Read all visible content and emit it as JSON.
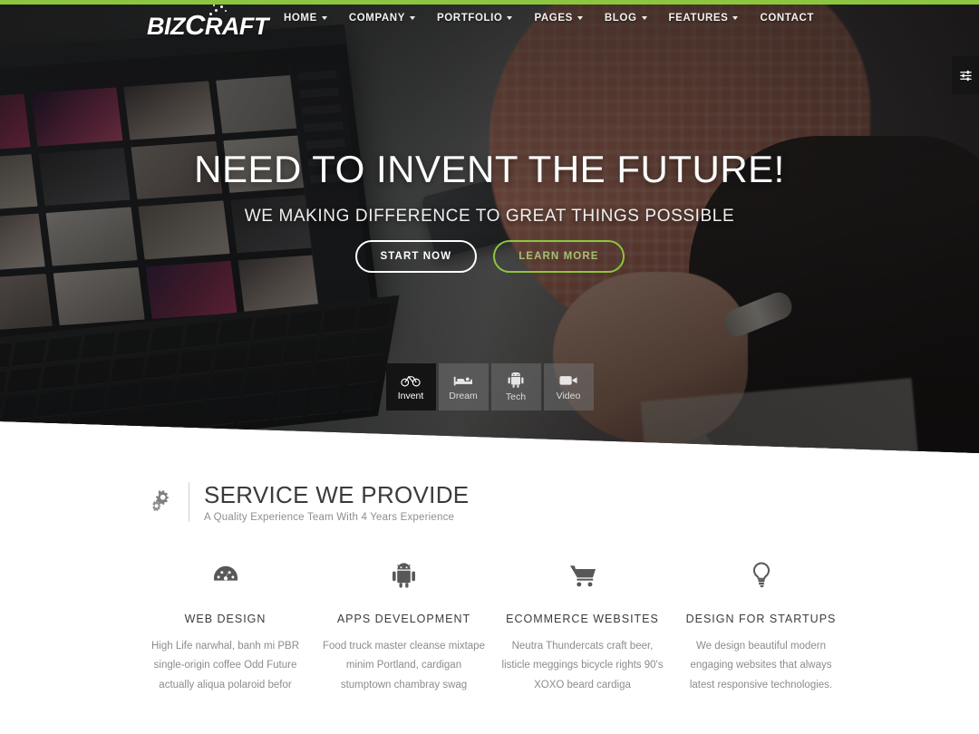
{
  "brand": {
    "logo_text_1": "B",
    "logo_text_2": "IZ",
    "logo_text_3": "C",
    "logo_text_4": "RAFT",
    "accent_color": "#8cc63e"
  },
  "header": {
    "nav": [
      {
        "label": "HOME",
        "has_dropdown": true
      },
      {
        "label": "COMPANY",
        "has_dropdown": true
      },
      {
        "label": "PORTFOLIO",
        "has_dropdown": true
      },
      {
        "label": "PAGES",
        "has_dropdown": true
      },
      {
        "label": "BLOG",
        "has_dropdown": true
      },
      {
        "label": "FEATURES",
        "has_dropdown": true
      },
      {
        "label": "CONTACT",
        "has_dropdown": false
      }
    ],
    "settings_icon": "sliders-icon"
  },
  "hero": {
    "title": "NEED TO INVENT THE FUTURE!",
    "subtitle": "WE MAKING DIFFERENCE TO GREAT THINGS POSSIBLE",
    "primary_button": "START NOW",
    "secondary_button": "LEARN MORE",
    "tabs": [
      {
        "label": "Invent",
        "icon": "bicycle-icon",
        "active": true
      },
      {
        "label": "Dream",
        "icon": "bed-icon",
        "active": false
      },
      {
        "label": "Tech",
        "icon": "android-icon",
        "active": false
      },
      {
        "label": "Video",
        "icon": "video-camera-icon",
        "active": false
      }
    ]
  },
  "services_section": {
    "icon": "gears-icon",
    "title": "SERVICE WE PROVIDE",
    "subtitle": "A Quality Experience Team With 4 Years Experience",
    "items": [
      {
        "icon": "dashboard-icon",
        "title": "WEB DESIGN",
        "description": "High Life narwhal, banh mi PBR single-origin coffee Odd Future actually aliqua polaroid befor"
      },
      {
        "icon": "android-icon",
        "title": "APPS DEVELOPMENT",
        "description": "Food truck master cleanse mixtape minim Portland, cardigan stumptown chambray swag"
      },
      {
        "icon": "shopping-cart-icon",
        "title": "ECOMMERCE WEBSITES",
        "description": "Neutra Thundercats craft beer, listicle meggings bicycle rights 90's XOXO beard cardiga"
      },
      {
        "icon": "lightbulb-icon",
        "title": "DESIGN FOR STARTUPS",
        "description": "We design beautiful modern engaging websites that always latest responsive technologies."
      }
    ]
  }
}
